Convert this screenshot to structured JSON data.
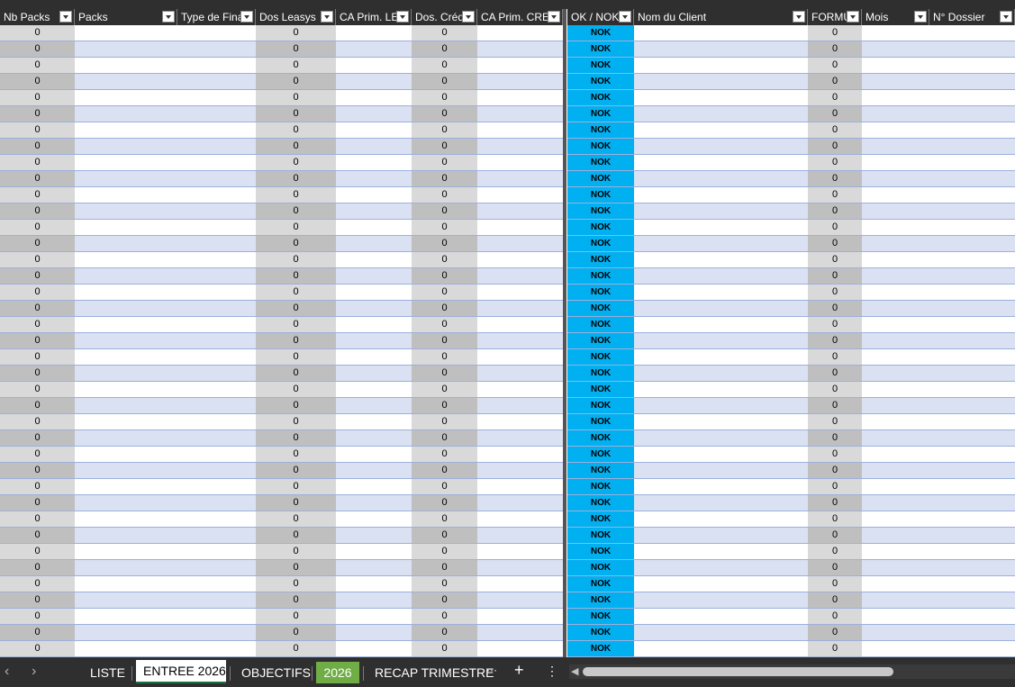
{
  "headers": [
    {
      "label": "Nb Packs",
      "name": "col-nb-packs"
    },
    {
      "label": "Packs",
      "name": "col-packs"
    },
    {
      "label": "Type de Fina",
      "name": "col-type-financement"
    },
    {
      "label": "Dos Leasys",
      "name": "col-dos-leasys"
    },
    {
      "label": "CA Prim. LEA",
      "name": "col-ca-prim-leasys"
    },
    {
      "label": "Dos. Créd",
      "name": "col-dos-credit"
    },
    {
      "label": "CA Prim. CRE",
      "name": "col-ca-prim-credit"
    },
    {
      "label": "OK / NOK",
      "name": "col-ok-nok"
    },
    {
      "label": "Nom du Client",
      "name": "col-nom-client"
    },
    {
      "label": "FORMU",
      "name": "col-formule"
    },
    {
      "label": "Mois",
      "name": "col-mois"
    },
    {
      "label": "N° Dossier",
      "name": "col-numero-dossier"
    }
  ],
  "row_values": {
    "nb_packs": "0",
    "dos_leasys": "0",
    "dos_credit": "0",
    "ok_nok": "NOK",
    "formule": "0"
  },
  "row_count": 39,
  "sheet_tabs": [
    {
      "label": "LISTE",
      "state": "normal"
    },
    {
      "label": "ENTREE 2026",
      "state": "active"
    },
    {
      "label": "OBJECTIFS",
      "state": "normal"
    },
    {
      "label": "2026",
      "state": "green"
    },
    {
      "label": "RECAP TRIMESTRE",
      "state": "normal"
    }
  ],
  "nav": {
    "prev": "‹",
    "next": "›",
    "more": "···",
    "add": "+",
    "options": "⋮"
  },
  "colors": {
    "header_bg": "#2f2f2f",
    "band_row": "#d9e1f2",
    "grey_col": "#d9d9d9",
    "grey_col_band": "#bfbfbf",
    "nok_bg": "#00b0f0",
    "tab_green": "#70ad47"
  }
}
